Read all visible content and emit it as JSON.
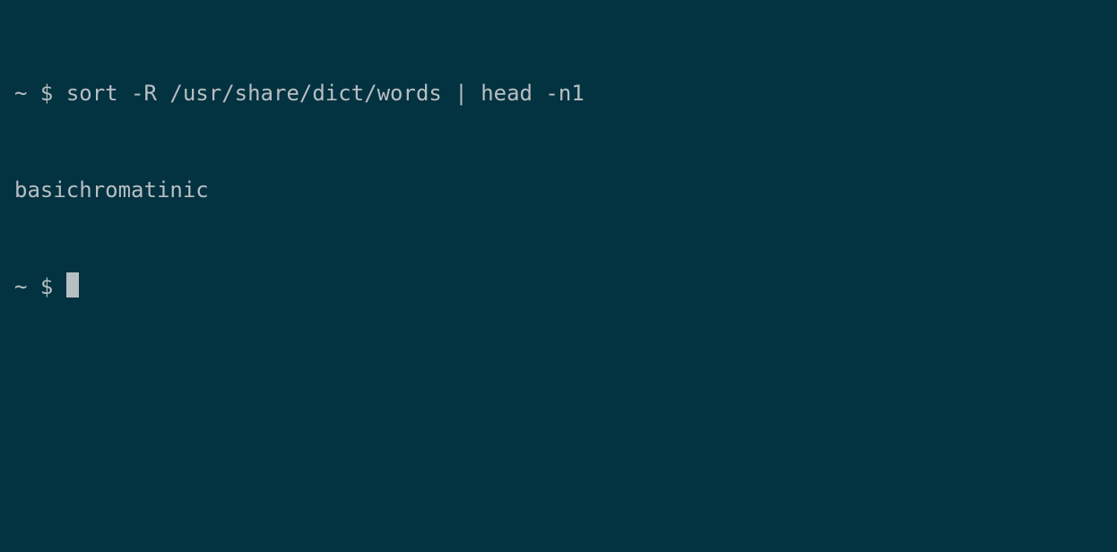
{
  "terminal": {
    "lines": [
      {
        "prompt_path": "~",
        "prompt_symbol": "$",
        "command": "sort -R /usr/share/dict/words | head -n1"
      }
    ],
    "output": "basichromatinic",
    "active_prompt": {
      "prompt_path": "~",
      "prompt_symbol": "$"
    }
  }
}
